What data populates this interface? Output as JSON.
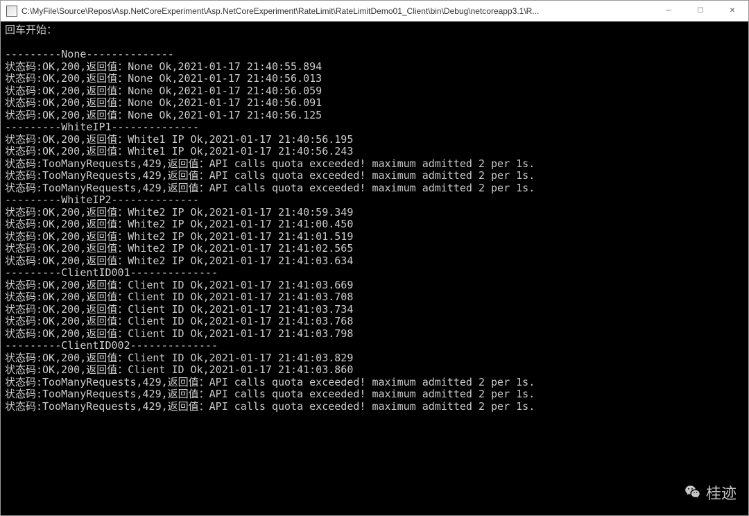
{
  "window": {
    "title": "C:\\MyFile\\Source\\Repos\\Asp.NetCoreExperiment\\Asp.NetCoreExperiment\\RateLimit\\RateLimitDemo01_Client\\bin\\Debug\\netcoreapp3.1\\R..."
  },
  "console": {
    "start_line": "回车开始：",
    "blank1": "",
    "sections": [
      {
        "divider": "---------None--------------",
        "lines": [
          "状态码:OK,200,返回值：None Ok,2021-01-17 21:40:55.894",
          "状态码:OK,200,返回值：None Ok,2021-01-17 21:40:56.013",
          "状态码:OK,200,返回值：None Ok,2021-01-17 21:40:56.059",
          "状态码:OK,200,返回值：None Ok,2021-01-17 21:40:56.091",
          "状态码:OK,200,返回值：None Ok,2021-01-17 21:40:56.125"
        ]
      },
      {
        "divider": "---------WhiteIP1--------------",
        "lines": [
          "状态码:OK,200,返回值：White1 IP Ok,2021-01-17 21:40:56.195",
          "状态码:OK,200,返回值：White1 IP Ok,2021-01-17 21:40:56.243",
          "状态码:TooManyRequests,429,返回值：API calls quota exceeded! maximum admitted 2 per 1s.",
          "状态码:TooManyRequests,429,返回值：API calls quota exceeded! maximum admitted 2 per 1s.",
          "状态码:TooManyRequests,429,返回值：API calls quota exceeded! maximum admitted 2 per 1s."
        ]
      },
      {
        "divider": "---------WhiteIP2--------------",
        "lines": [
          "状态码:OK,200,返回值：White2 IP Ok,2021-01-17 21:40:59.349",
          "状态码:OK,200,返回值：White2 IP Ok,2021-01-17 21:41:00.450",
          "状态码:OK,200,返回值：White2 IP Ok,2021-01-17 21:41:01.519",
          "状态码:OK,200,返回值：White2 IP Ok,2021-01-17 21:41:02.565",
          "状态码:OK,200,返回值：White2 IP Ok,2021-01-17 21:41:03.634"
        ]
      },
      {
        "divider": "---------ClientID001--------------",
        "lines": [
          "状态码:OK,200,返回值：Client ID Ok,2021-01-17 21:41:03.669",
          "状态码:OK,200,返回值：Client ID Ok,2021-01-17 21:41:03.708",
          "状态码:OK,200,返回值：Client ID Ok,2021-01-17 21:41:03.734",
          "状态码:OK,200,返回值：Client ID Ok,2021-01-17 21:41:03.768",
          "状态码:OK,200,返回值：Client ID Ok,2021-01-17 21:41:03.798"
        ]
      },
      {
        "divider": "---------ClientID002--------------",
        "lines": [
          "状态码:OK,200,返回值：Client ID Ok,2021-01-17 21:41:03.829",
          "状态码:OK,200,返回值：Client ID Ok,2021-01-17 21:41:03.860",
          "状态码:TooManyRequests,429,返回值：API calls quota exceeded! maximum admitted 2 per 1s.",
          "状态码:TooManyRequests,429,返回值：API calls quota exceeded! maximum admitted 2 per 1s.",
          "状态码:TooManyRequests,429,返回值：API calls quota exceeded! maximum admitted 2 per 1s."
        ]
      }
    ]
  },
  "watermark": {
    "text": "桂迹"
  }
}
